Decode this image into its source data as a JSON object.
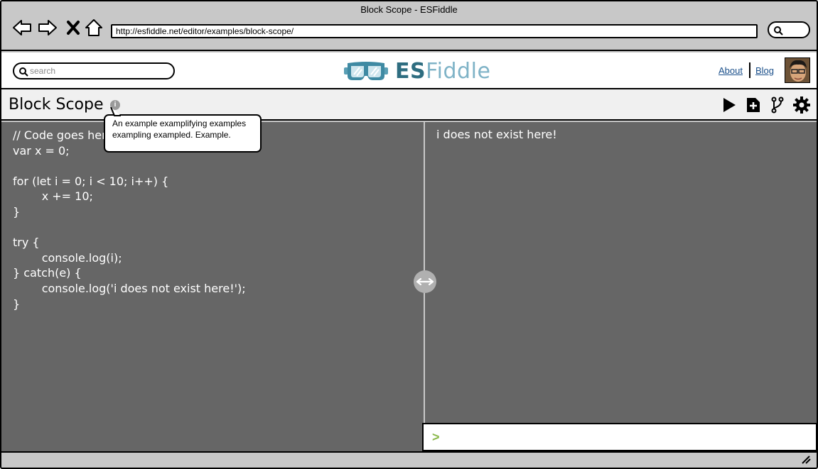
{
  "window": {
    "title": "Block Scope - ESFiddle"
  },
  "browser": {
    "url": "http://esfiddle.net/editor/examples/block-scope/"
  },
  "header": {
    "search_placeholder": "search",
    "logo_es": "ES",
    "logo_fiddle": "Fiddle",
    "about_label": "About",
    "blog_label": "Blog"
  },
  "toolbar": {
    "title": "Block Scope",
    "info_glyph": "i",
    "tooltip": "An example examplifying examples exampling exampled. Example."
  },
  "editor": {
    "lines": [
      "// Code goes here",
      "var x = 0;",
      "",
      "for (let i = 0; i < 10; i++) {",
      "        x += 10;",
      "}",
      "",
      "try {",
      "        console.log(i);",
      "} catch(e) {",
      "        console.log('i does not exist here!');",
      "}"
    ]
  },
  "output": {
    "text": "i does not exist here!"
  },
  "console": {
    "prompt": ">"
  },
  "icons": {
    "back": "back-arrow-icon",
    "forward": "forward-arrow-icon",
    "stop": "close-icon",
    "home": "home-icon",
    "run": "play-icon",
    "new": "new-file-icon",
    "fork": "fork-icon",
    "settings": "gear-icon"
  },
  "colors": {
    "editor_bg": "#666666",
    "logo_dark": "#2e6d80",
    "logo_light": "#7fb3c7",
    "console_prompt": "#8ab84a",
    "link": "#1a4f8a"
  }
}
